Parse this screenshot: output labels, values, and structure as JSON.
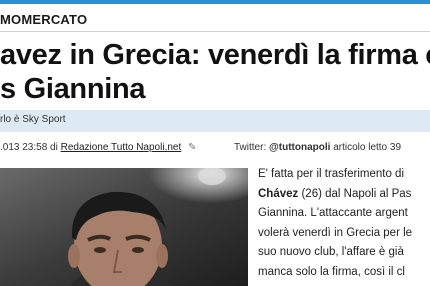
{
  "article": {
    "section": "MOMERCATO",
    "headline_line1": "avez in Grecia: venerdì la firma c",
    "headline_line2": "s Giannina",
    "subtitle": "rlo è Sky Sport",
    "meta": {
      "date": ".013 23:58 di",
      "author": "Redazione Tutto Napoli.net",
      "twitter_label": "Twitter:",
      "twitter_handle": "@tuttonapoli",
      "views": "articolo letto 39"
    },
    "body": {
      "line1": "E' fatta per il trasferimento di",
      "line2_bold": "Chávez",
      "line2_rest": " (26) dal Napoli al Pas",
      "line3": "Giannina. L'attaccante argent",
      "line4": "volerà venerdì in Grecia per le",
      "line5": "suo nuovo club, l'affare è già",
      "line6": "manca solo la firma, così il cl"
    }
  },
  "colors": {
    "topbar": "#2b8fd6",
    "subbar": "#dde9f3"
  },
  "icons": {
    "edit": "pencil-icon"
  }
}
